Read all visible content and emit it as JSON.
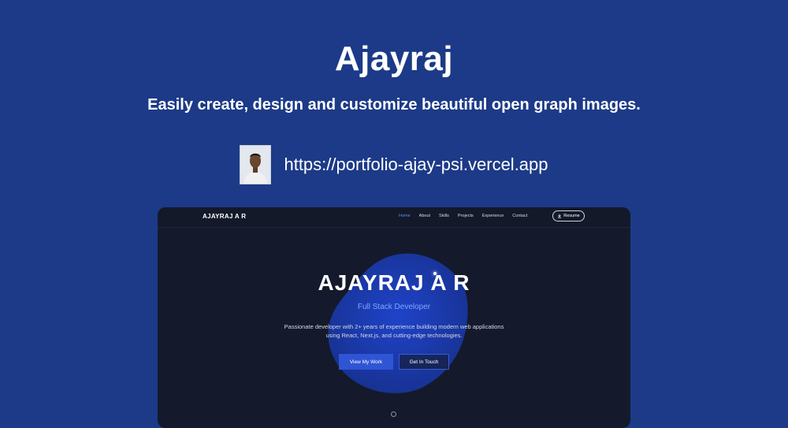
{
  "og": {
    "title": "Ajayraj",
    "subtitle": "Easily create, design and customize beautiful open graph images.",
    "url": "https://portfolio-ajay-psi.vercel.app"
  },
  "site": {
    "brand": "AJAYRAJ A R",
    "nav": [
      "Home",
      "About",
      "Skills",
      "Projects",
      "Experience",
      "Contact"
    ],
    "active_nav": "Home",
    "resume_label": "Resume",
    "hero": {
      "name": "AJAYRAJ A R",
      "role": "Full Stack Developer",
      "description": "Passionate developer with 2+ years of experience building modern web applications using React, Next.js, and cutting-edge technologies.",
      "primary_button": "View My Work",
      "secondary_button": "Get In Touch"
    }
  },
  "colors": {
    "background": "#1c3a87",
    "card": "#141a2b",
    "accent": "#2f55d4",
    "blob": "#1a3bb8"
  },
  "icons": {
    "resume": "download-icon",
    "avatar": "profile-photo"
  }
}
